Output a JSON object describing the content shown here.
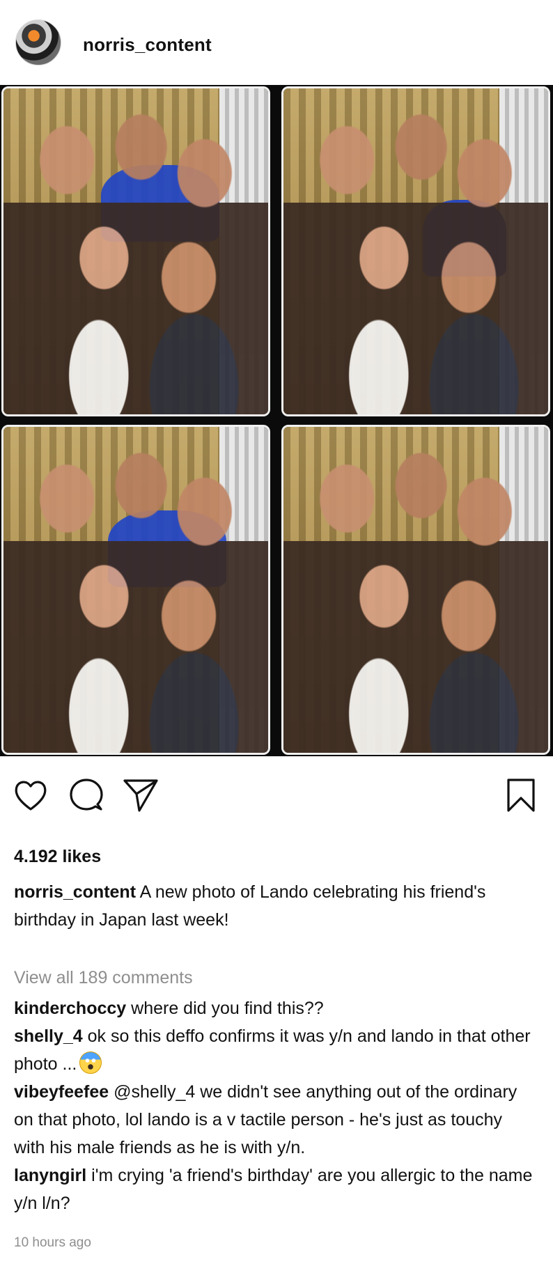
{
  "post": {
    "username": "norris_content",
    "likes": "4.192 likes",
    "caption_user": "norris_content",
    "caption_text": " A new photo of Lando celebrating his friend's birthday in Japan last week!",
    "view_all": "View all 189 comments",
    "timestamp": "10 hours ago"
  },
  "comments": [
    {
      "user": "kinderchoccy",
      "text": " where did you find this??"
    },
    {
      "user": "shelly_4",
      "text": " ok so this deffo confirms it was y/n and lando in that other photo ...",
      "emoji": "face-screaming-in-fear"
    },
    {
      "user": "vibeyfeefee",
      "text": " @shelly_4 we didn't see anything out of the ordinary on that photo, lol lando is a v tactile person - he's just as touchy with his male friends as he is with y/n."
    },
    {
      "user": "lanyngirl",
      "text": " i'm crying 'a friend's birthday' are you allergic to the name y/n l/n?"
    }
  ],
  "icons": {
    "like": "heart-icon",
    "comment": "comment-icon",
    "share": "send-icon",
    "save": "bookmark-icon"
  },
  "colors": {
    "text": "#111111",
    "muted": "#8e8e8e",
    "photo_background": "#0b0b0b"
  }
}
